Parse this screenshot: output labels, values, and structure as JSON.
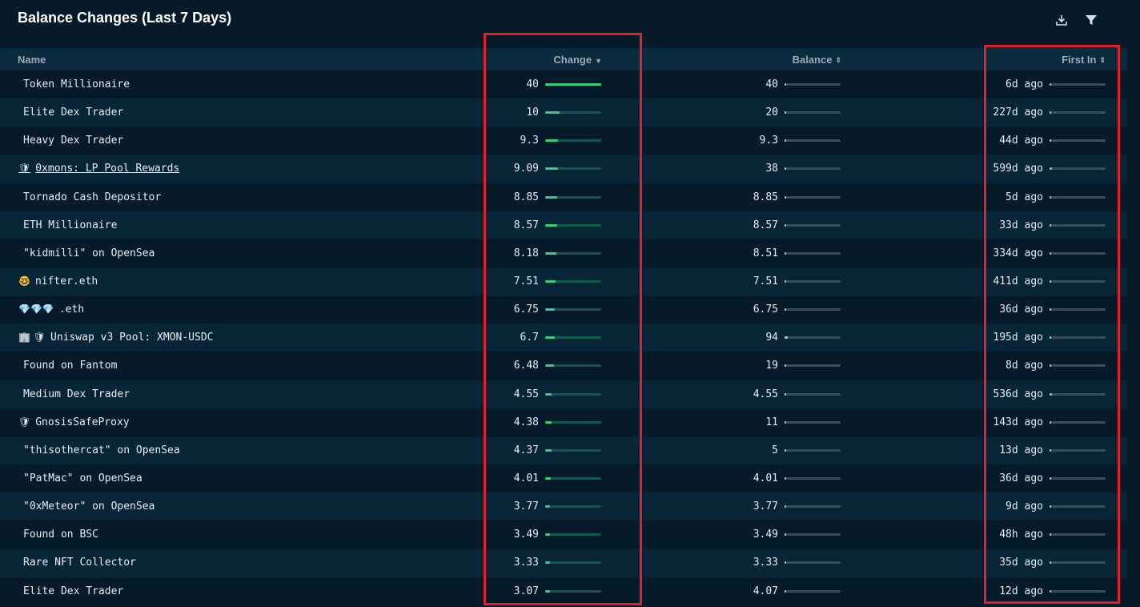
{
  "header": {
    "title": "Balance Changes (Last 7 Days)",
    "download_icon": "download-icon",
    "filter_icon": "filter-icon"
  },
  "columns": {
    "name": "Name",
    "change": "Change",
    "balance": "Balance",
    "first_in": "First In"
  },
  "colors": {
    "background": "#061a2a",
    "change_bar": "#35d07f",
    "highlight_box": "#e0202a"
  },
  "rows": [
    {
      "icons": "",
      "name": "Token Millionaire",
      "change": "40",
      "change_level": 1.0,
      "balance": "40",
      "balance_level": 0.03,
      "first_in": "6d ago",
      "first_level": 0.0
    },
    {
      "icons": "",
      "name": "Elite Dex Trader",
      "change": "10",
      "change_level": 0.25,
      "balance": "20",
      "balance_level": 0.02,
      "first_in": "227d ago",
      "first_level": 0.03
    },
    {
      "icons": "",
      "name": "Heavy Dex Trader",
      "change": "9.3",
      "change_level": 0.23,
      "balance": "9.3",
      "balance_level": 0.01,
      "first_in": "44d ago",
      "first_level": 0.01
    },
    {
      "icons": "🛡",
      "name": "0xmons: LP Pool Rewards",
      "link": true,
      "change": "9.09",
      "change_level": 0.23,
      "balance": "38",
      "balance_level": 0.03,
      "first_in": "599d ago",
      "first_level": 0.04
    },
    {
      "icons": "",
      "name": "Tornado Cash Depositor",
      "change": "8.85",
      "change_level": 0.22,
      "balance": "8.85",
      "balance_level": 0.01,
      "first_in": "5d ago",
      "first_level": 0.0
    },
    {
      "icons": "",
      "name": "ETH Millionaire",
      "change": "8.57",
      "change_level": 0.21,
      "balance": "8.57",
      "balance_level": 0.01,
      "first_in": "33d ago",
      "first_level": 0.01
    },
    {
      "icons": "",
      "name": "\"kidmilli\" on OpenSea",
      "change": "8.18",
      "change_level": 0.2,
      "balance": "8.51",
      "balance_level": 0.01,
      "first_in": "334d ago",
      "first_level": 0.03
    },
    {
      "icons": "🤓",
      "name": "nifter.eth",
      "change": "7.51",
      "change_level": 0.19,
      "balance": "7.51",
      "balance_level": 0.01,
      "first_in": "411d ago",
      "first_level": 0.03
    },
    {
      "icons": "💎💎💎",
      "name": ".eth",
      "change": "6.75",
      "change_level": 0.17,
      "balance": "6.75",
      "balance_level": 0.01,
      "first_in": "36d ago",
      "first_level": 0.01
    },
    {
      "icons": "🏢 🛡",
      "name": "Uniswap v3 Pool: XMON-USDC",
      "change": "6.7",
      "change_level": 0.17,
      "balance": "94",
      "balance_level": 0.05,
      "first_in": "195d ago",
      "first_level": 0.02
    },
    {
      "icons": "",
      "name": "Found on Fantom",
      "change": "6.48",
      "change_level": 0.16,
      "balance": "19",
      "balance_level": 0.02,
      "first_in": "8d ago",
      "first_level": 0.0
    },
    {
      "icons": "",
      "name": "Medium Dex Trader",
      "change": "4.55",
      "change_level": 0.11,
      "balance": "4.55",
      "balance_level": 0.01,
      "first_in": "536d ago",
      "first_level": 0.04
    },
    {
      "icons": "🛡",
      "name": "GnosisSafeProxy",
      "change": "4.38",
      "change_level": 0.11,
      "balance": "11",
      "balance_level": 0.01,
      "first_in": "143d ago",
      "first_level": 0.02
    },
    {
      "icons": "",
      "name": "\"thisothercat\" on OpenSea",
      "change": "4.37",
      "change_level": 0.11,
      "balance": "5",
      "balance_level": 0.01,
      "first_in": "13d ago",
      "first_level": 0.0
    },
    {
      "icons": "",
      "name": "\"PatMac\" on OpenSea",
      "change": "4.01",
      "change_level": 0.1,
      "balance": "4.01",
      "balance_level": 0.01,
      "first_in": "36d ago",
      "first_level": 0.01
    },
    {
      "icons": "",
      "name": "\"0xMeteor\" on OpenSea",
      "change": "3.77",
      "change_level": 0.09,
      "balance": "3.77",
      "balance_level": 0.01,
      "first_in": "9d ago",
      "first_level": 0.0
    },
    {
      "icons": "",
      "name": "Found on BSC",
      "change": "3.49",
      "change_level": 0.09,
      "balance": "3.49",
      "balance_level": 0.01,
      "first_in": "48h ago",
      "first_level": 0.0
    },
    {
      "icons": "",
      "name": "Rare NFT Collector",
      "change": "3.33",
      "change_level": 0.08,
      "balance": "3.33",
      "balance_level": 0.01,
      "first_in": "35d ago",
      "first_level": 0.01
    },
    {
      "icons": "",
      "name": "Elite Dex Trader",
      "change": "3.07",
      "change_level": 0.08,
      "balance": "4.07",
      "balance_level": 0.01,
      "first_in": "12d ago",
      "first_level": 0.0
    }
  ]
}
